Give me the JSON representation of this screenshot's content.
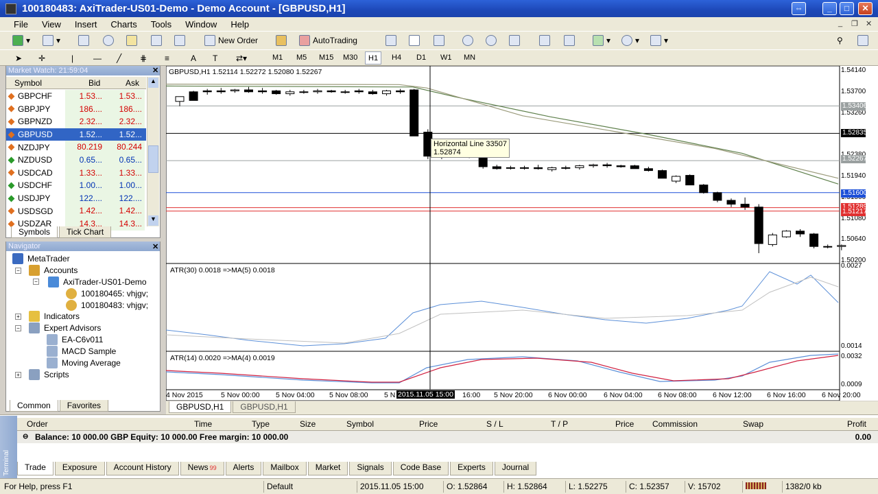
{
  "window": {
    "title": "100180483: AxiTrader-US01-Demo - Demo Account - [GBPUSD,H1]"
  },
  "menu": [
    "File",
    "View",
    "Insert",
    "Charts",
    "Tools",
    "Window",
    "Help"
  ],
  "toolbar": {
    "new_order": "New Order",
    "autotrading": "AutoTrading",
    "timeframes": [
      "M1",
      "M5",
      "M15",
      "M30",
      "H1",
      "H4",
      "D1",
      "W1",
      "MN"
    ],
    "active_timeframe": "H1",
    "text_tool": "A"
  },
  "market_watch": {
    "title": "Market Watch: 21:59:04",
    "columns": [
      "Symbol",
      "Bid",
      "Ask"
    ],
    "rows": [
      {
        "symbol": "GBPCHF",
        "bid": "1.53...",
        "ask": "1.53...",
        "bidcolor": "red",
        "askcolor": "red",
        "icon": "#e07020"
      },
      {
        "symbol": "GBPJPY",
        "bid": "186....",
        "ask": "186....",
        "bidcolor": "red",
        "askcolor": "red",
        "icon": "#e07020"
      },
      {
        "symbol": "GBPNZD",
        "bid": "2.32...",
        "ask": "2.32...",
        "bidcolor": "red",
        "askcolor": "red",
        "icon": "#e07020"
      },
      {
        "symbol": "GBPUSD",
        "bid": "1.52...",
        "ask": "1.52...",
        "bidcolor": "sel",
        "askcolor": "sel",
        "icon": "#e07020",
        "selected": true
      },
      {
        "symbol": "NZDJPY",
        "bid": "80.219",
        "ask": "80.244",
        "bidcolor": "red",
        "askcolor": "red",
        "icon": "#e07020"
      },
      {
        "symbol": "NZDUSD",
        "bid": "0.65...",
        "ask": "0.65...",
        "bidcolor": "blue",
        "askcolor": "blue",
        "icon": "#2a9a2a"
      },
      {
        "symbol": "USDCAD",
        "bid": "1.33...",
        "ask": "1.33...",
        "bidcolor": "red",
        "askcolor": "red",
        "icon": "#e07020"
      },
      {
        "symbol": "USDCHF",
        "bid": "1.00...",
        "ask": "1.00...",
        "bidcolor": "blue",
        "askcolor": "blue",
        "icon": "#2a9a2a"
      },
      {
        "symbol": "USDJPY",
        "bid": "122....",
        "ask": "122....",
        "bidcolor": "blue",
        "askcolor": "blue",
        "icon": "#2a9a2a"
      },
      {
        "symbol": "USDSGD",
        "bid": "1.42...",
        "ask": "1.42...",
        "bidcolor": "red",
        "askcolor": "red",
        "icon": "#e07020"
      },
      {
        "symbol": "USDZAR",
        "bid": "14.3...",
        "ask": "14.3...",
        "bidcolor": "red",
        "askcolor": "red",
        "icon": "#e07020"
      }
    ],
    "tabs": [
      "Symbols",
      "Tick Chart"
    ]
  },
  "navigator": {
    "title": "Navigator",
    "root": "MetaTrader",
    "accounts": "Accounts",
    "server": "AxiTrader-US01-Demo",
    "acc1": "100180465: vhjgv;",
    "acc2": "100180483: vhjgv;",
    "indicators": "Indicators",
    "experts": "Expert Advisors",
    "ea1": "EA-C6v011",
    "ea2": "MACD Sample",
    "ea3": "Moving Average",
    "scripts": "Scripts",
    "tabs": [
      "Common",
      "Favorites"
    ]
  },
  "chart": {
    "header": "GBPUSD,H1  1.52114 1.52272 1.52080 1.52267",
    "tooltip_line1": "Horizontal Line 33507",
    "tooltip_line2": "1.52874",
    "price_ticks": [
      "1.54140",
      "1.53700",
      "1.53260",
      "1.52820",
      "1.52380",
      "1.51940",
      "1.51500",
      "1.51080",
      "1.50640",
      "1.50200"
    ],
    "boxes": [
      {
        "label": "1.53406",
        "color": "#9aa0a0"
      },
      {
        "label": "1.52835",
        "color": "#000000"
      },
      {
        "label": "1.52267",
        "color": "#9aa0a0"
      },
      {
        "label": "1.51600",
        "color": "#1b4fd8"
      },
      {
        "label": "1.51289",
        "color": "#e03030"
      },
      {
        "label": "1.51217",
        "color": "#e03030"
      }
    ],
    "atr30_label": "ATR(30) 0.0018 =>MA(5) 0.0018",
    "atr30_ticks": [
      "0.0027",
      "0.0014"
    ],
    "atr14_label": "ATR(14) 0.0020 =>MA(4) 0.0019",
    "atr14_ticks": [
      "0.0032",
      "0.0009"
    ],
    "time_ticks": [
      "4 Nov 2015",
      "5 Nov 00:00",
      "5 Nov 04:00",
      "5 Nov 08:00",
      "5 N",
      "16:00",
      "5 Nov 20:00",
      "6 Nov 00:00",
      "6 Nov 04:00",
      "6 Nov 08:00",
      "6 Nov 12:00",
      "6 Nov 16:00",
      "6 Nov 20:00"
    ],
    "crosshair_time": "2015.11.05 15:00",
    "tabs": [
      "GBPUSD,H1",
      "GBPUSD,H1"
    ]
  },
  "terminal": {
    "side_label": "Terminal",
    "columns": [
      "Order",
      "Time",
      "Type",
      "Size",
      "Symbol",
      "Price",
      "S / L",
      "T / P",
      "Price",
      "Commission",
      "Swap",
      "Profit"
    ],
    "balance_text": "Balance: 10 000.00 GBP  Equity: 10 000.00  Free margin: 10 000.00",
    "profit_total": "0.00",
    "tabs": [
      "Trade",
      "Exposure",
      "Account History",
      "News",
      "Alerts",
      "Mailbox",
      "Market",
      "Signals",
      "Code Base",
      "Experts",
      "Journal"
    ],
    "news_badge": "99"
  },
  "status": {
    "help": "For Help, press F1",
    "profile": "Default",
    "time": "2015.11.05 15:00",
    "open": "O: 1.52864",
    "high": "H: 1.52864",
    "low": "L: 1.52275",
    "close": "C: 1.52357",
    "volume": "V: 15702",
    "traffic": "1382/0 kb"
  },
  "colors": {
    "selection": "#3165c5",
    "ma_line": "#6a8a5a",
    "red_line": "#e03030",
    "blue_line": "#1b4fd8"
  }
}
